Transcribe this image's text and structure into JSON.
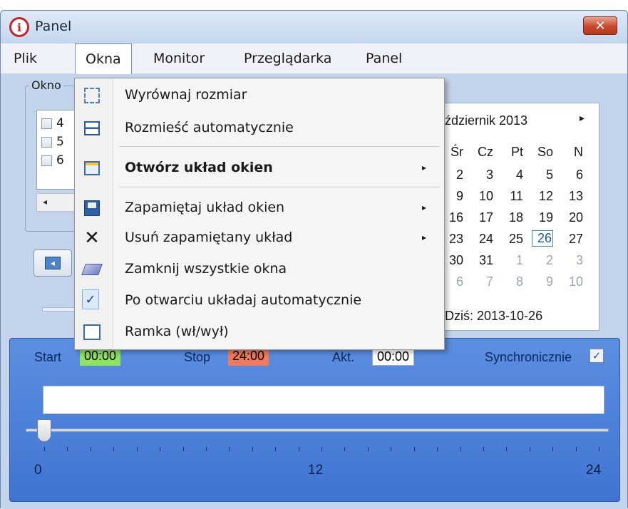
{
  "window": {
    "title": "Panel",
    "close_label": "✕",
    "app_icon_glyph": "i"
  },
  "menubar": {
    "items": [
      "Plik",
      "Okna",
      "Monitor",
      "Przeglądarka",
      "Panel"
    ]
  },
  "okna_group": {
    "label": "Okno",
    "list_items": [
      "4",
      "5",
      "6"
    ],
    "scroll_left": "◂"
  },
  "calendar": {
    "month_label": "ździernik 2013",
    "next_arrow": "▸",
    "weekdays": [
      "Śr",
      "Cz",
      "Pt",
      "So",
      "N"
    ],
    "rows": [
      [
        "2",
        "3",
        "4",
        "5",
        "6"
      ],
      [
        "9",
        "10",
        "11",
        "12",
        "13"
      ],
      [
        "16",
        "17",
        "18",
        "19",
        "20"
      ],
      [
        "23",
        "24",
        "25",
        "26",
        "27"
      ],
      [
        "30",
        "31",
        "1",
        "2",
        "3"
      ],
      [
        "6",
        "7",
        "8",
        "9",
        "10"
      ]
    ],
    "today_day": "26",
    "today_label": "Dziś: 2013-10-26"
  },
  "dropdown": {
    "items": [
      {
        "icon": "resize-icon",
        "label": "Wyrównaj rozmiar",
        "bold": false,
        "submenu": false
      },
      {
        "icon": "tile-icon",
        "label": "Rozmieść automatycznie",
        "bold": false,
        "submenu": false
      },
      {
        "icon": "open-layout-icon",
        "label": "Otwórz układ okien",
        "bold": true,
        "submenu": true
      },
      {
        "icon": "save-icon",
        "label": "Zapamiętaj układ okien",
        "bold": false,
        "submenu": true
      },
      {
        "icon": "delete-icon",
        "label": "Usuń zapamiętany układ",
        "bold": false,
        "submenu": true
      },
      {
        "icon": "close-all-icon",
        "label": "Zamknij wszystkie okna",
        "bold": false,
        "submenu": false
      },
      {
        "icon": "check-icon",
        "label": "Po otwarciu układaj automatycznie",
        "bold": false,
        "submenu": false
      },
      {
        "icon": "frame-icon",
        "label": "Ramka (wł/wył)",
        "bold": false,
        "submenu": false
      }
    ],
    "submenu_arrow": "▸"
  },
  "timeline": {
    "start_label": "Start",
    "start_value": "00:00",
    "start_color": "#8fe35e",
    "stop_label": "Stop",
    "stop_value": "24:00",
    "stop_color": "#f07a5c",
    "akt_label": "Akt.",
    "akt_value": "00:00",
    "sync_label": "Synchronicznie",
    "sync_checked": "✓",
    "slider_min": "0",
    "slider_mid": "12",
    "slider_max": "24",
    "slider_value": 0
  }
}
